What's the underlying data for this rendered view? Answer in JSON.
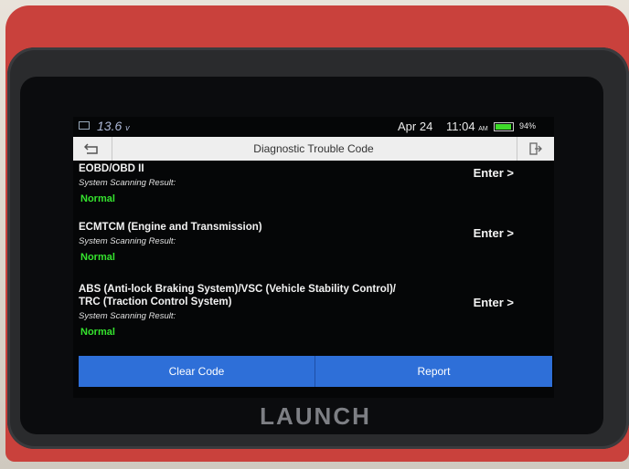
{
  "device": {
    "brand": "LAUNCH"
  },
  "status": {
    "voltage": "13.6",
    "voltage_unit": "v",
    "date": "Apr 24",
    "time": "11:04",
    "ampm": "AM",
    "battery_pct": "94%",
    "battery_level": 0.94,
    "battery_color": "#3fdc2a"
  },
  "titlebar": {
    "title": "Diagnostic Trouble Code"
  },
  "systems": [
    {
      "name": "EOBD/OBD II",
      "name2": "",
      "label": "System Scanning Result:",
      "result": "Normal",
      "action": "Enter >"
    },
    {
      "name": "ECMTCM (Engine and Transmission)",
      "name2": "",
      "label": "System Scanning Result:",
      "result": "Normal",
      "action": "Enter >"
    },
    {
      "name": "ABS (Anti-lock Braking System)/VSC (Vehicle Stability Control)/",
      "name2": "TRC (Traction Control System)",
      "label": "System Scanning Result:",
      "result": "Normal",
      "action": "Enter >"
    }
  ],
  "buttons": {
    "clear": "Clear Code",
    "report": "Report"
  },
  "colors": {
    "accent": "#2e6fd8",
    "result_ok": "#35e32e",
    "device_shell": "#c9413c"
  }
}
